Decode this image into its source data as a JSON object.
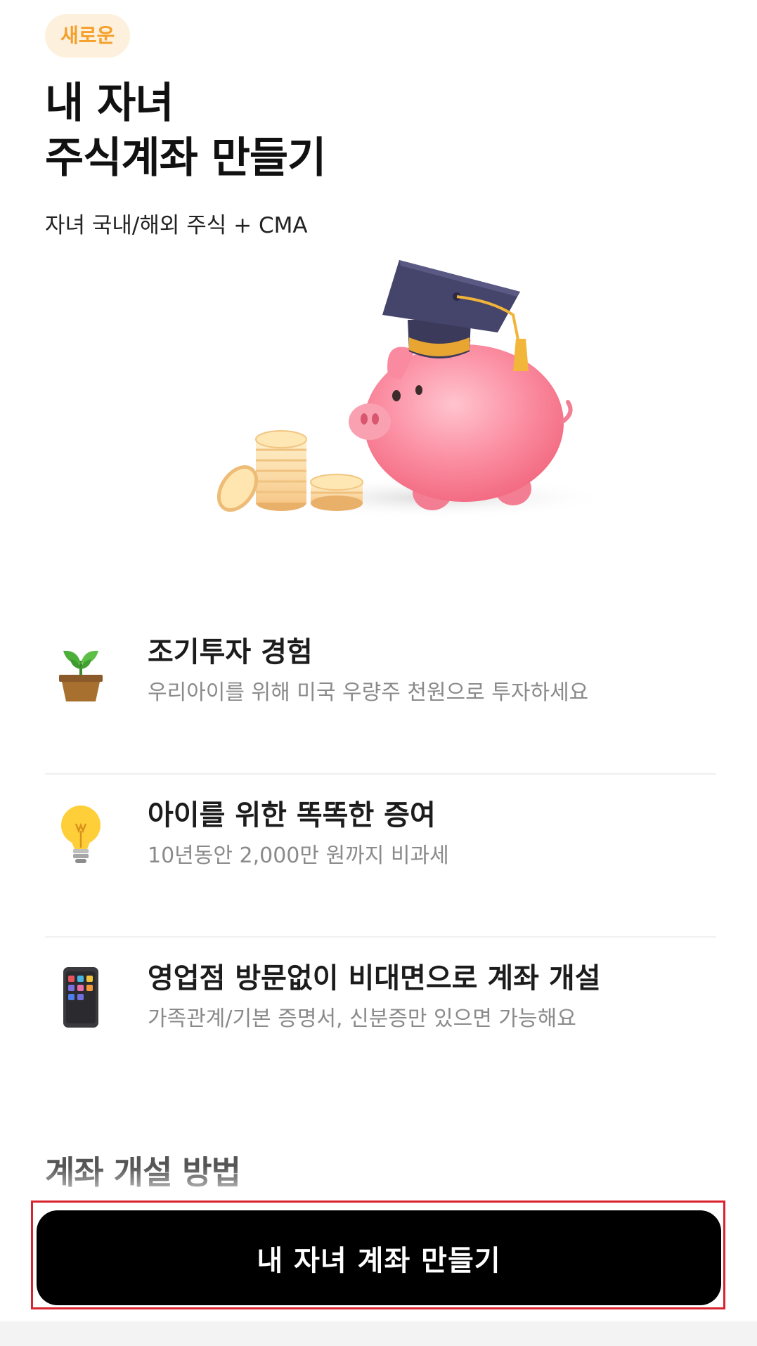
{
  "badge": "새로운",
  "title": {
    "line1": "내 자녀",
    "line2": "주식계좌 만들기"
  },
  "subtitle": "자녀 국내/해외 주식 + CMA",
  "features": [
    {
      "icon": "plant-sprout-icon",
      "title": "조기투자 경험",
      "desc": "우리아이를 위해 미국 우량주 천원으로 투자하세요"
    },
    {
      "icon": "lightbulb-icon",
      "title": "아이를 위한 똑똑한 증여",
      "desc": "10년동안 2,000만 원까지 비과세"
    },
    {
      "icon": "smartphone-icon",
      "title": "영업점 방문없이 비대면으로 계좌 개설",
      "desc": "가족관계/기본 증명서, 신분증만 있으면 가능해요"
    }
  ],
  "section": {
    "title": "계좌 개설 방법"
  },
  "cta": {
    "label": "내 자녀 계좌 만들기"
  },
  "colors": {
    "badge_bg": "#fdf0dd",
    "badge_text": "#f5a02a",
    "cta_bg": "#000000",
    "cta_text": "#ffffff",
    "highlight_frame": "#d9232e",
    "desc_text": "#8a8a8a"
  }
}
